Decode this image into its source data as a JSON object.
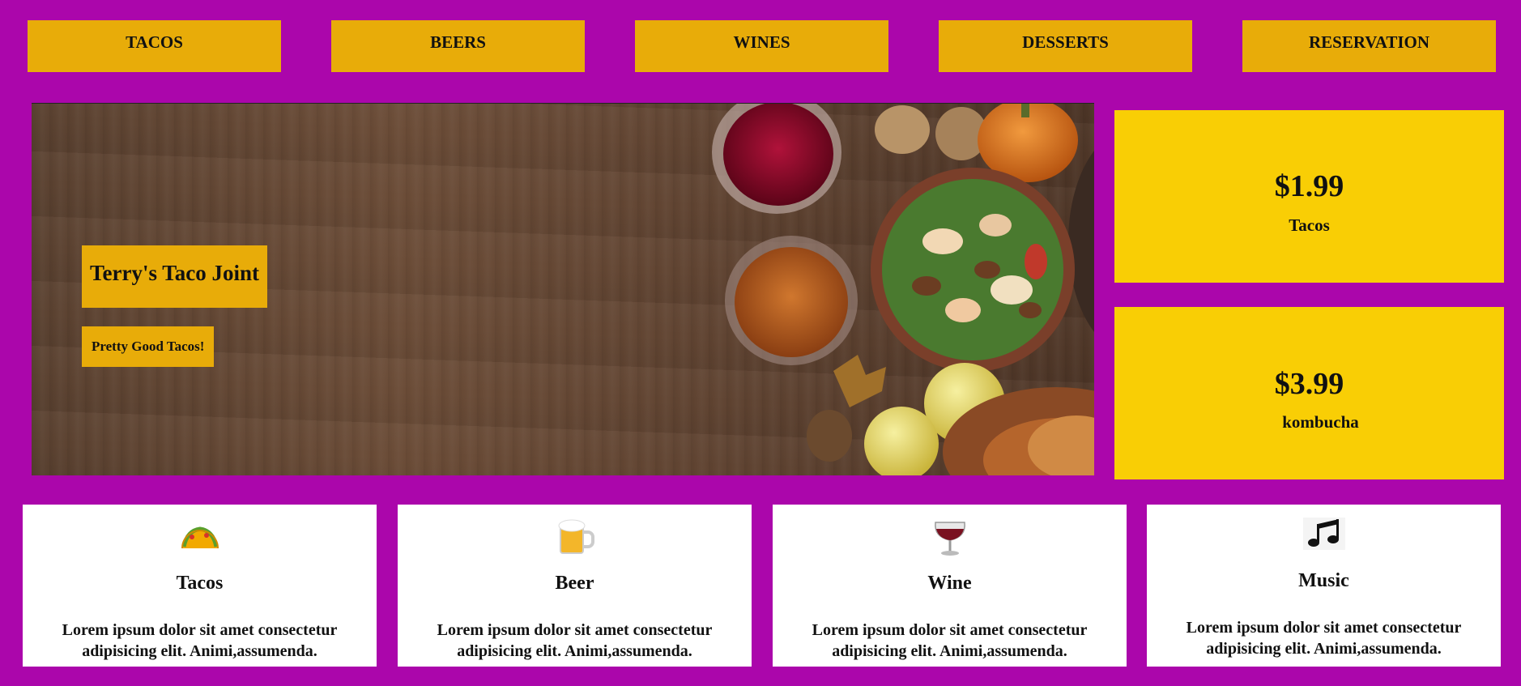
{
  "nav": {
    "items": [
      {
        "label": "TACOS"
      },
      {
        "label": "BEERS"
      },
      {
        "label": "WINES"
      },
      {
        "label": "DESSERTS"
      },
      {
        "label": "RESERVATION"
      }
    ]
  },
  "hero": {
    "title": "Terry's Taco Joint",
    "subtitle": "Pretty Good Tacos!"
  },
  "prices": [
    {
      "amount": "$1.99",
      "label": "Tacos"
    },
    {
      "amount": "$3.99",
      "label": "kombucha"
    }
  ],
  "features": [
    {
      "icon": "taco-icon",
      "title": "Tacos",
      "text": "Lorem ipsum dolor sit amet consectetur adipisicing elit. Animi,assumenda."
    },
    {
      "icon": "beer-mug-icon",
      "title": "Beer",
      "text": "Lorem ipsum dolor sit amet consectetur adipisicing elit. Animi,assumenda."
    },
    {
      "icon": "wine-glass-icon",
      "title": "Wine",
      "text": "Lorem ipsum dolor sit amet consectetur adipisicing elit. Animi,assumenda."
    },
    {
      "icon": "music-notes-icon",
      "title": "Music",
      "text": "Lorem ipsum dolor sit amet consectetur adipisicing elit. Animi,assumenda."
    }
  ],
  "colors": {
    "background": "#ab06ab",
    "nav_button": "#e8ac09",
    "price_card": "#f9ce05",
    "feature_card": "#ffffff"
  }
}
